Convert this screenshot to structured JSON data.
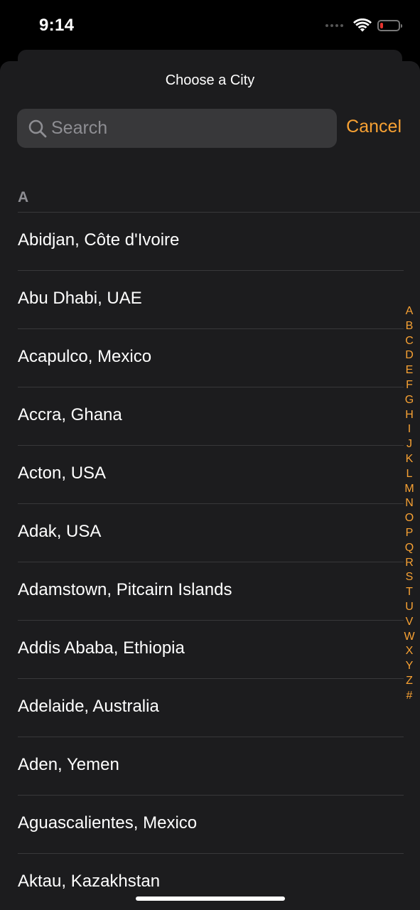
{
  "status_bar": {
    "time": "9:14",
    "battery_level": 0.15,
    "battery_color": "#e5332e"
  },
  "sheet": {
    "title": "Choose a City"
  },
  "search": {
    "placeholder": "Search",
    "value": "",
    "icon": "search-icon"
  },
  "cancel_label": "Cancel",
  "accent_color": "#f7a133",
  "section": {
    "header": "A",
    "cities": [
      "Abidjan, Côte d'Ivoire",
      "Abu Dhabi, UAE",
      "Acapulco, Mexico",
      "Accra, Ghana",
      "Acton, USA",
      "Adak, USA",
      "Adamstown, Pitcairn Islands",
      "Addis Ababa, Ethiopia",
      "Adelaide, Australia",
      "Aden, Yemen",
      "Aguascalientes, Mexico",
      "Aktau, Kazakhstan"
    ]
  },
  "index_letters": [
    "A",
    "B",
    "C",
    "D",
    "E",
    "F",
    "G",
    "H",
    "I",
    "J",
    "K",
    "L",
    "M",
    "N",
    "O",
    "P",
    "Q",
    "R",
    "S",
    "T",
    "U",
    "V",
    "W",
    "X",
    "Y",
    "Z",
    "#"
  ]
}
